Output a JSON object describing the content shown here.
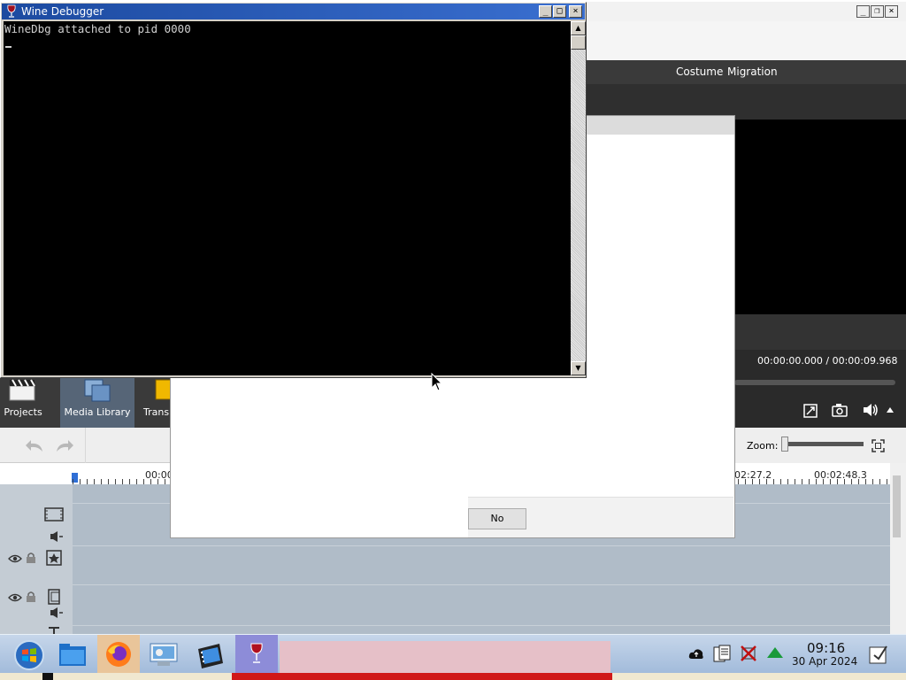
{
  "wine_debugger": {
    "title": "Wine Debugger",
    "console_text": "WineDbg attached to pid 0000",
    "controls": {
      "minimize": "_",
      "maximize": "□",
      "close": "×"
    }
  },
  "app": {
    "menu": [
      "Costume",
      "Migration"
    ],
    "timecode": "00:00:00.000 / 00:00:09.968",
    "left_tabs": [
      "Projects",
      "Media Library",
      "Transi"
    ],
    "zoom_label": "Zoom:",
    "ruler_labels": [
      "00:00",
      "02:27.2",
      "00:02:48.3"
    ],
    "controls": {
      "minimize": "_",
      "restore": "❐",
      "close": "×"
    }
  },
  "dialog": {
    "no_button": "No"
  },
  "taskbar": {
    "clock_time": "09:16",
    "clock_date": "30 Apr 2024",
    "icons": [
      "start-orb",
      "file-manager",
      "firefox",
      "control-panel",
      "video-editor",
      "wine"
    ]
  },
  "colors": {
    "console_bg": "#000000",
    "wine_title": "#1c4aa0",
    "app_dark": "#3a3a3a",
    "timeline_bg": "#b0bcc8"
  }
}
